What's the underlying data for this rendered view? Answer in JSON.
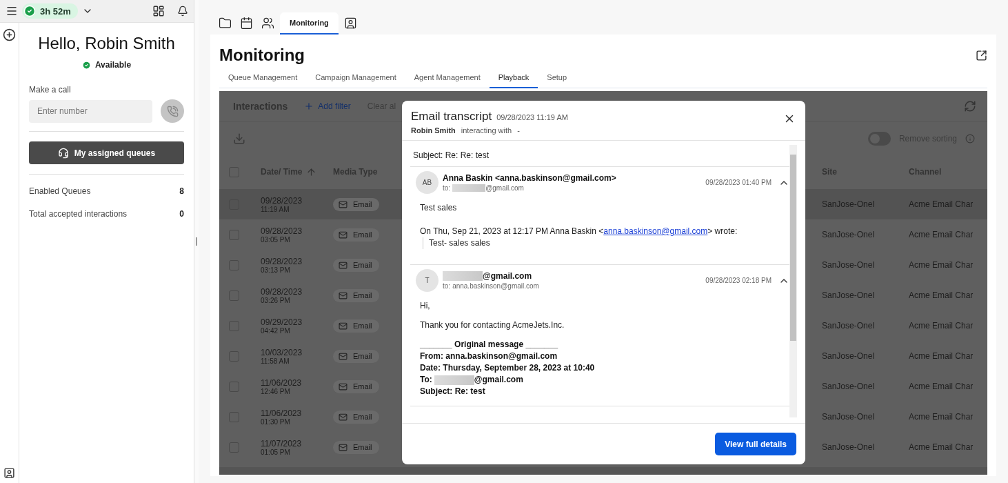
{
  "header": {
    "timer": "3h 52m"
  },
  "agent": {
    "greeting": "Hello, Robin Smith",
    "status": "Available",
    "call_label": "Make a call",
    "number_placeholder": "Enter number",
    "call_disabled": true,
    "queues_button": "My assigned queues",
    "stats": [
      {
        "label": "Enabled Queues",
        "value": "8"
      },
      {
        "label": "Total accepted interactions",
        "value": "0"
      }
    ]
  },
  "tabs": [
    {
      "kind": "icon",
      "selected": false
    },
    {
      "kind": "icon",
      "selected": false
    },
    {
      "kind": "icon",
      "selected": false
    },
    {
      "kind": "text",
      "label": "Monitoring",
      "selected": true
    },
    {
      "kind": "icon",
      "selected": false
    }
  ],
  "page": {
    "title": "Monitoring",
    "subtabs": [
      {
        "label": "Queue Management",
        "selected": false
      },
      {
        "label": "Campaign Management",
        "selected": false
      },
      {
        "label": "Agent Management",
        "selected": false
      },
      {
        "label": "Playback",
        "selected": true
      },
      {
        "label": "Setup",
        "selected": false
      }
    ]
  },
  "interactions": {
    "title": "Interactions",
    "add_filter": "Add filter",
    "clear_all": "Clear al",
    "sort_toggle": {
      "label": "Remove sorting",
      "on": false
    },
    "all_checked": false,
    "columns": [
      {
        "label": "Date/ Time",
        "sorted": true
      },
      {
        "label": "Media Type",
        "sorted": false
      },
      {
        "label": "Site",
        "sorted": false
      },
      {
        "label": "Channel",
        "sorted": false
      }
    ],
    "rows": [
      {
        "date": "09/28/2023",
        "time": "11:19 AM",
        "media": "Email",
        "site": "SanJose-Onel",
        "channel": "Acme Email Char",
        "checked": false,
        "selected": true
      },
      {
        "date": "09/28/2023",
        "time": "03:05 PM",
        "media": "Email",
        "site": "SanJose-Onel",
        "channel": "Acme Email Char",
        "checked": false,
        "selected": false
      },
      {
        "date": "09/28/2023",
        "time": "03:13 PM",
        "media": "Email",
        "site": "SanJose-Onel",
        "channel": "Acme Email Char",
        "checked": false,
        "selected": false
      },
      {
        "date": "09/28/2023",
        "time": "03:26 PM",
        "media": "Email",
        "site": "SanJose-Onel",
        "channel": "Acme Email Char",
        "checked": false,
        "selected": false
      },
      {
        "date": "09/29/2023",
        "time": "04:42 PM",
        "media": "Email",
        "site": "SanJose-Onel",
        "channel": "Acme Email Char",
        "checked": false,
        "selected": false
      },
      {
        "date": "10/03/2023",
        "time": "11:58 AM",
        "media": "Email",
        "site": "SanJose-Onel",
        "channel": "Acme Email Char",
        "checked": false,
        "selected": false
      },
      {
        "date": "11/06/2023",
        "time": "12:46 PM",
        "media": "Email",
        "site": "SanJose-Onel",
        "channel": "Acme Email Char",
        "checked": false,
        "selected": false
      },
      {
        "date": "11/06/2023",
        "time": "01:30 PM",
        "media": "Email",
        "site": "SanJose-Onel",
        "channel": "Acme Email Char",
        "checked": false,
        "selected": false
      },
      {
        "date": "11/07/2023",
        "time": "01:05 PM",
        "media": "Email",
        "site": "SanJose-Onel",
        "channel": "Acme Email Char",
        "checked": false,
        "selected": false
      }
    ]
  },
  "transcript": {
    "title": "Email transcript",
    "date": "09/28/2023 11:19 AM",
    "agent": "Robin Smith",
    "interacting": "interacting with",
    "contact": "-",
    "subject": "Subject: Re: Re: test",
    "messages": [
      {
        "avatar": "AB",
        "sender": "Anna Baskin <anna.baskinson@gmail.com>",
        "sender_redacted": false,
        "to_label": "to:",
        "to": "@gmail.com",
        "to_redacted": true,
        "time": "09/28/2023 01:40 PM",
        "expanded": true,
        "body": [
          {
            "kind": "text",
            "text": "Test sales"
          },
          {
            "kind": "reply",
            "before": "On Thu, Sep 21, 2023 at 12:17 PM Anna Baskin <",
            "link": "anna.baskinson@gmail.com",
            "after": "> wrote:"
          },
          {
            "kind": "quote",
            "text": "Test- sales sales"
          }
        ]
      },
      {
        "avatar": "T",
        "sender": "@gmail.com",
        "sender_redacted": true,
        "to_label": "to:",
        "to": "anna.baskinson@gmail.com",
        "to_redacted": false,
        "time": "09/28/2023 02:18 PM",
        "expanded": true,
        "body": [
          {
            "kind": "text",
            "text": "Hi,"
          },
          {
            "kind": "text",
            "text": "Thank you for contacting AcmeJets.Inc."
          },
          {
            "kind": "bold",
            "text": "_______ Original message _______"
          },
          {
            "kind": "bold",
            "text": "From: anna.baskinson@gmail.com"
          },
          {
            "kind": "bold",
            "text": "Date: Thursday, September 28, 2023 at 10:40"
          },
          {
            "kind": "redacted",
            "label": "To:",
            "text": "@gmail.com"
          },
          {
            "kind": "bold",
            "text": "Subject: Re: test"
          }
        ]
      }
    ],
    "button": "View full details"
  }
}
